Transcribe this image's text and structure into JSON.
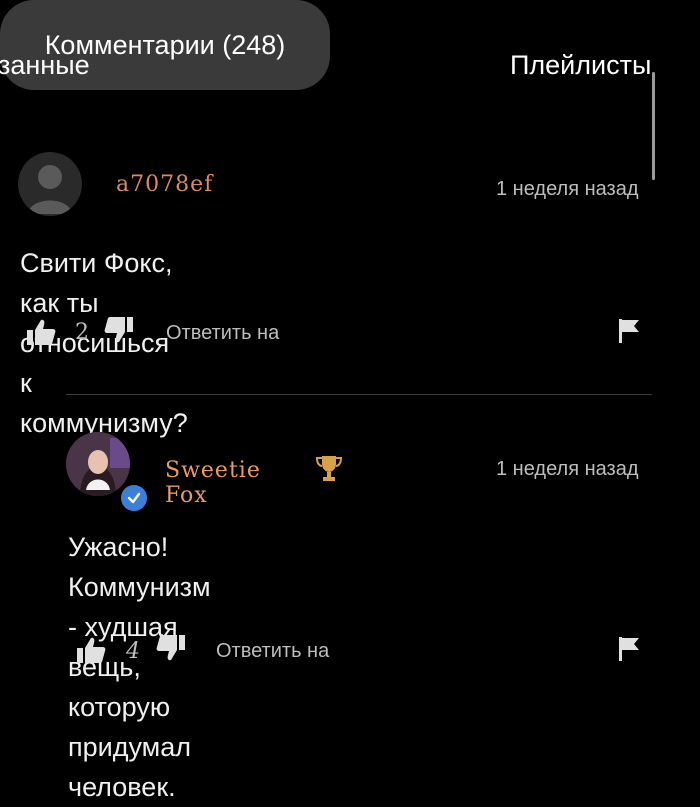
{
  "tabs": {
    "left": "занные",
    "active": "Комментарии (248)",
    "right": "Плейлисты"
  },
  "comments": [
    {
      "username": "a7078ef",
      "username_color": "#d98a6a",
      "timestamp": "1 неделя назад",
      "text": "Свити Фокс, как ты относишься к коммунизму?",
      "likes": "2",
      "reply_label": "Ответить на",
      "icons": [
        "thumbs-up-icon",
        "thumbs-down-icon",
        "flag-icon"
      ]
    },
    {
      "username": "Sweetie Fox",
      "username_color": "#e89a6c",
      "timestamp": "1 неделя назад",
      "text_line1": "Ужасно! Коммунизм - худшая вещь,",
      "text_line2": "которую придумал человек.",
      "likes": "4",
      "reply_label": "Ответить на",
      "icons": [
        "trophy-icon",
        "verified-icon",
        "thumbs-up-icon",
        "thumbs-down-icon",
        "flag-icon"
      ]
    }
  ]
}
